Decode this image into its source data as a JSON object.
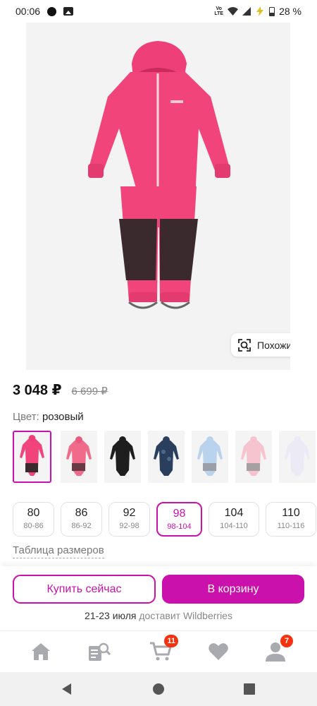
{
  "status_bar": {
    "time": "00:06",
    "network": "VoLTE",
    "battery": "28 %"
  },
  "gallery": {
    "similar_label": "Похожие"
  },
  "product": {
    "price_current": "3 048 ₽",
    "price_old": "6 699 ₽",
    "color_label": "Цвет:",
    "color_value": "розовый",
    "thumbnails": [
      {
        "name": "pink-black",
        "selected": true
      },
      {
        "name": "pink-print"
      },
      {
        "name": "black"
      },
      {
        "name": "navy-camo"
      },
      {
        "name": "light-blue"
      },
      {
        "name": "light-pink"
      },
      {
        "name": "white-lilac"
      }
    ],
    "sizes": [
      {
        "main": "80",
        "sub": "80-86"
      },
      {
        "main": "86",
        "sub": "86-92"
      },
      {
        "main": "92",
        "sub": "92-98"
      },
      {
        "main": "98",
        "sub": "98-104",
        "selected": true
      },
      {
        "main": "104",
        "sub": "104-110"
      },
      {
        "main": "110",
        "sub": "110-116"
      }
    ],
    "size_table_link": "Таблица размеров"
  },
  "purchase": {
    "buy_now_label": "Купить сейчас",
    "add_to_cart_label": "В корзину",
    "delivery_dates": "21-23 июля",
    "delivery_suffix": "доставит Wildberries"
  },
  "bottom_nav": {
    "items": [
      {
        "icon": "home-icon"
      },
      {
        "icon": "catalog-search-icon"
      },
      {
        "icon": "cart-icon",
        "badge": "11"
      },
      {
        "icon": "heart-icon"
      },
      {
        "icon": "profile-icon",
        "badge": "7"
      }
    ]
  },
  "colors": {
    "accent": "#cb11ab",
    "badge": "#f6310f",
    "product_pink": "#f0447a"
  }
}
